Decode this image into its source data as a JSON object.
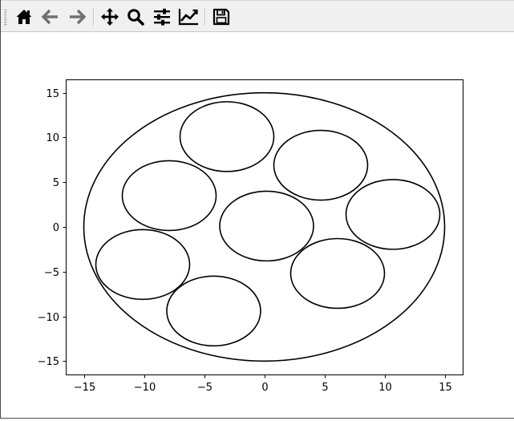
{
  "toolbar": {
    "buttons": [
      {
        "name": "home-button",
        "icon": "home-icon"
      },
      {
        "name": "back-button",
        "icon": "arrow-left-icon"
      },
      {
        "name": "forward-button",
        "icon": "arrow-right-icon"
      },
      {
        "name": "pan-button",
        "icon": "move-icon"
      },
      {
        "name": "zoom-button",
        "icon": "magnifier-icon"
      },
      {
        "name": "configure-subplots-button",
        "icon": "sliders-icon"
      },
      {
        "name": "edit-axis-button",
        "icon": "line-chart-icon"
      },
      {
        "name": "save-button",
        "icon": "floppy-disk-icon"
      }
    ]
  },
  "colors": {
    "line": "#000000",
    "toolbar_bg": "#f0f0f0",
    "icon": "#000000",
    "icon_disabled": "#707070"
  },
  "chart_data": {
    "type": "line",
    "title": "",
    "xlabel": "",
    "ylabel": "",
    "xlim": [
      -16.5,
      16.5
    ],
    "ylim": [
      -16.5,
      16.5
    ],
    "xticks": [
      -15,
      -10,
      -5,
      0,
      5,
      10,
      15
    ],
    "yticks": [
      -15,
      -10,
      -5,
      0,
      5,
      10,
      15
    ],
    "xtick_labels": [
      "−15",
      "−10",
      "−5",
      "0",
      "5",
      "10",
      "15"
    ],
    "ytick_labels": [
      "−15",
      "−10",
      "−5",
      "0",
      "5",
      "10",
      "15"
    ],
    "grid": false,
    "legend": false,
    "circles": [
      {
        "cx": 0,
        "cy": 0,
        "r": 15
      },
      {
        "cx": 0.2,
        "cy": 0.1,
        "r": 3.9
      },
      {
        "cx": -3.1,
        "cy": 10.1,
        "r": 3.9
      },
      {
        "cx": 4.7,
        "cy": 6.9,
        "r": 3.9
      },
      {
        "cx": 10.7,
        "cy": 1.4,
        "r": 3.9
      },
      {
        "cx": 6.1,
        "cy": -5.2,
        "r": 3.9
      },
      {
        "cx": -4.2,
        "cy": -9.4,
        "r": 3.9
      },
      {
        "cx": -10.1,
        "cy": -4.2,
        "r": 3.9
      },
      {
        "cx": -7.9,
        "cy": 3.5,
        "r": 3.9
      }
    ]
  }
}
